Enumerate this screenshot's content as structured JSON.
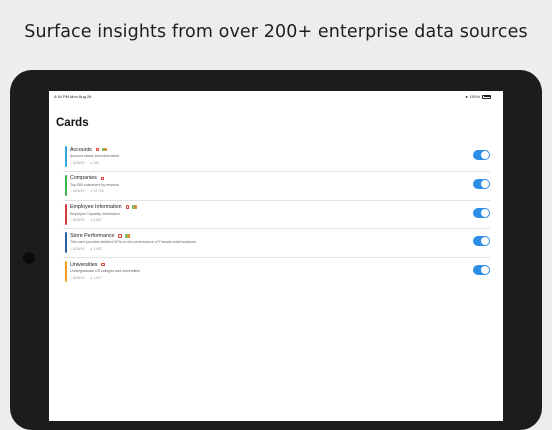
{
  "headline": "Surface insights from over 200+ enterprise data sources",
  "status_bar": {
    "time": "4:16 PM   Mon Aug 26",
    "battery": "100%"
  },
  "page": {
    "title": "Cards"
  },
  "cards": [
    {
      "title": "Accounts",
      "description": "Account status and information",
      "date": "6/26/19",
      "count": "784",
      "accent": "#2fa6d9",
      "flag": true,
      "enabled": true
    },
    {
      "title": "Companies",
      "description": "Top 500 customers by revenue",
      "date": "6/26/19",
      "count": "12,700",
      "accent": "#3cb54a",
      "flag": false,
      "enabled": true
    },
    {
      "title": "Employee Information",
      "description": "Employee Capacity Information",
      "date": "6/26/19",
      "count": "2,847",
      "accent": "#d63a3a",
      "flag": true,
      "enabled": true
    },
    {
      "title": "Store Performance",
      "description": "This card provides detailed KPIs on the performance of Threads retail locations.",
      "date": "6/26/19",
      "count": "1,592",
      "accent": "#2b5fa8",
      "flag": true,
      "enabled": true
    },
    {
      "title": "Universities",
      "description": "Undergraduate US colleges and universities",
      "date": "6/26/19",
      "count": "1,817",
      "accent": "#f2a31b",
      "flag": false,
      "enabled": true
    }
  ]
}
